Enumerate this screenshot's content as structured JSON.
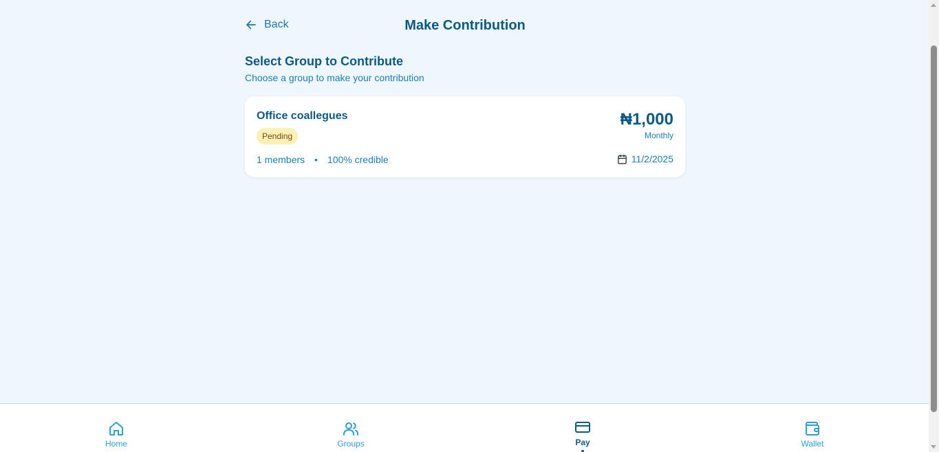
{
  "header": {
    "back_label": "Back",
    "title": "Make Contribution"
  },
  "section": {
    "title": "Select Group to Contribute",
    "subtitle": "Choose a group to make your contribution"
  },
  "groups": [
    {
      "name": "Office coallegues",
      "status": "Pending",
      "amount": "₦1,000",
      "frequency": "Monthly",
      "members": "1 members",
      "separator": "•",
      "credibility": "100% credible",
      "date": "11/2/2025"
    }
  ],
  "nav": {
    "items": [
      {
        "label": "Home",
        "icon": "home-icon"
      },
      {
        "label": "Groups",
        "icon": "users-icon"
      },
      {
        "label": "Pay",
        "icon": "credit-card-icon",
        "active": true
      },
      {
        "label": "Wallet",
        "icon": "wallet-icon"
      }
    ]
  },
  "colors": {
    "background": "#eff7fe",
    "primary": "#0b5a86",
    "accent": "#2b9ed8",
    "badge_bg": "#fbf0b6"
  }
}
